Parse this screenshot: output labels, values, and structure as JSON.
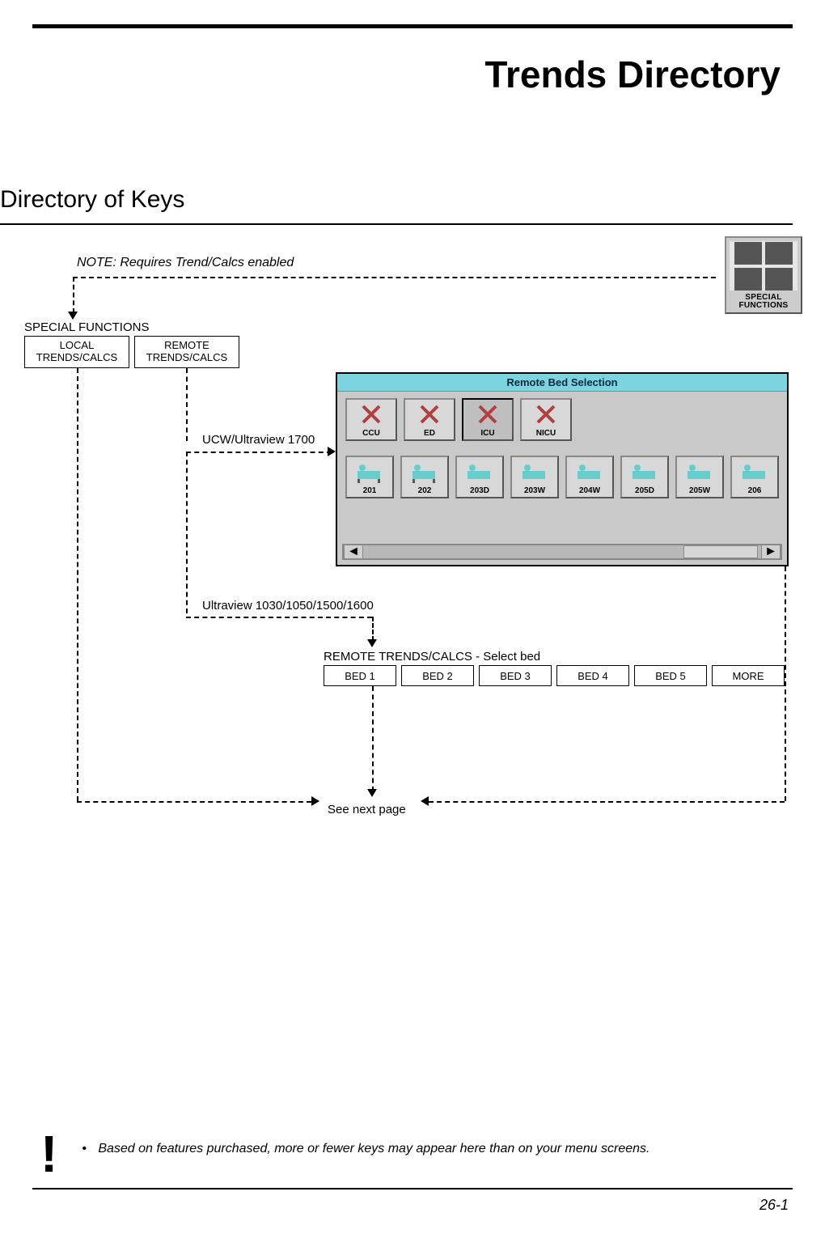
{
  "page": {
    "title": "Trends Directory",
    "section": "Directory of Keys",
    "page_number": "26-1"
  },
  "diagram": {
    "note": "NOTE: Requires Trend/Calcs enabled",
    "special_fn_label": "SPECIAL FUNCTIONS",
    "special_icon_caption_l1": "SPECIAL",
    "special_icon_caption_l2": "FUNCTIONS",
    "buttons_top": [
      {
        "l1": "LOCAL",
        "l2": "TRENDS/CALCS"
      },
      {
        "l1": "REMOTE",
        "l2": "TRENDS/CALCS"
      }
    ],
    "path_label_1700": "UCW/Ultraview 1700",
    "path_label_ultra": "Ultraview 1030/1050/1500/1600",
    "remote_select_label": "REMOTE TRENDS/CALCS - Select bed",
    "bed_buttons": [
      "BED 1",
      "BED 2",
      "BED 3",
      "BED 4",
      "BED 5",
      "MORE"
    ],
    "see_next": "See next page"
  },
  "remote_bed": {
    "title": "Remote Bed Selection",
    "units": [
      "CCU",
      "ED",
      "ICU",
      "NICU"
    ],
    "beds": [
      "201",
      "202",
      "203D",
      "203W",
      "204W",
      "205D",
      "205W",
      "206"
    ]
  },
  "important_note": "Based on features purchased, more or fewer keys may appear here than on your menu screens."
}
